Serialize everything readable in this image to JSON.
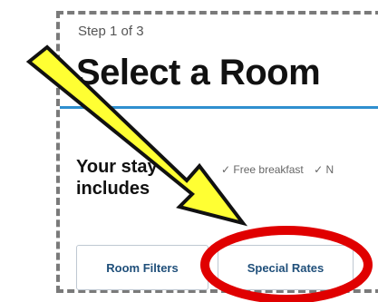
{
  "header": {
    "step": "Step 1 of 3",
    "title": "Select a Room"
  },
  "stay": {
    "label": "Your stay includes",
    "amenities": [
      "✓ Free breakfast",
      "✓ N"
    ]
  },
  "filters": {
    "room_filters": "Room Filters",
    "special_rates": "Special Rates"
  },
  "annotations": {
    "arrow_color": "#ffff33",
    "circle_color": "#e00000"
  }
}
